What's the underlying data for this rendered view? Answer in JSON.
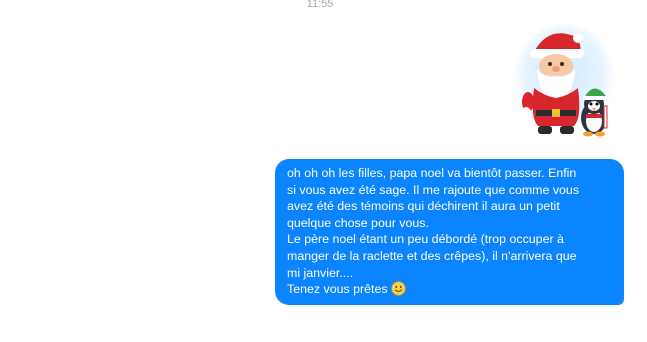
{
  "conversation": {
    "timestamp": "11:55",
    "sticker": {
      "icon": "santa-claus-with-elf-penguin-sticker"
    },
    "message": {
      "lines": [
        "oh oh oh les filles, papa noel va bientôt passer. Enfin",
        "si vous avez été sage. Il me rajoute que comme vous",
        "avez été des témoins qui déchirent il aura un petit",
        "quelque chose pour vous.",
        "Le père noel étant un peu débordé (trop occuper à",
        "manger de la raclette et des crêpes), il n'arrivera que",
        "mi janvier....",
        "Tenez vous prêtes"
      ],
      "emoji": "slightly-smiling-face-icon",
      "bubble_color": "#0a84ff",
      "text_color": "#ffffff"
    }
  }
}
